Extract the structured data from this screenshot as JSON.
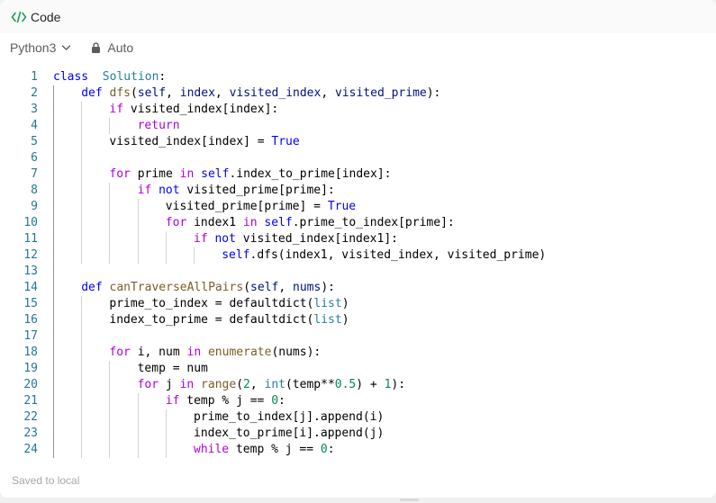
{
  "title": {
    "label": "Code",
    "icon": "code-icon"
  },
  "toolbar": {
    "language": "Python3",
    "mode_label": "Auto"
  },
  "status": {
    "text": "Saved to local"
  },
  "colors": {
    "keyword": "#0000ff",
    "control": "#af00db",
    "type": "#267f99",
    "function": "#795e26",
    "param": "#001080",
    "number": "#098658",
    "line_number": "#237893"
  },
  "code": {
    "lines": [
      {
        "n": "1",
        "indent": 0,
        "tokens": [
          [
            "k",
            "class"
          ],
          [
            "",
            "  "
          ],
          [
            "t",
            "Solution"
          ],
          [
            "",
            ":"
          ]
        ]
      },
      {
        "n": "2",
        "indent": 1,
        "tokens": [
          [
            "k",
            "def"
          ],
          [
            "",
            " "
          ],
          [
            "f",
            "dfs"
          ],
          [
            "",
            "("
          ],
          [
            "p",
            "self"
          ],
          [
            "",
            ", "
          ],
          [
            "p",
            "index"
          ],
          [
            "",
            ", "
          ],
          [
            "p",
            "visited_index"
          ],
          [
            "",
            ", "
          ],
          [
            "p",
            "visited_prime"
          ],
          [
            "",
            "):"
          ]
        ]
      },
      {
        "n": "3",
        "indent": 2,
        "tokens": [
          [
            "c",
            "if"
          ],
          [
            "",
            " visited_index[index]:"
          ]
        ]
      },
      {
        "n": "4",
        "indent": 3,
        "tokens": [
          [
            "c",
            "return"
          ]
        ]
      },
      {
        "n": "5",
        "indent": 2,
        "tokens": [
          [
            "",
            "visited_index[index] = "
          ],
          [
            "s",
            "True"
          ]
        ]
      },
      {
        "n": "6",
        "indent": 0,
        "tokens": []
      },
      {
        "n": "7",
        "indent": 2,
        "tokens": [
          [
            "c",
            "for"
          ],
          [
            "",
            " prime "
          ],
          [
            "c",
            "in"
          ],
          [
            "",
            " "
          ],
          [
            "s",
            "self"
          ],
          [
            "",
            ".index_to_prime[index]:"
          ]
        ]
      },
      {
        "n": "8",
        "indent": 3,
        "tokens": [
          [
            "c",
            "if"
          ],
          [
            "",
            " "
          ],
          [
            "k",
            "not"
          ],
          [
            "",
            " visited_prime[prime]:"
          ]
        ]
      },
      {
        "n": "9",
        "indent": 4,
        "tokens": [
          [
            "",
            "visited_prime[prime] = "
          ],
          [
            "s",
            "True"
          ]
        ]
      },
      {
        "n": "10",
        "indent": 4,
        "tokens": [
          [
            "c",
            "for"
          ],
          [
            "",
            " index1 "
          ],
          [
            "c",
            "in"
          ],
          [
            "",
            " "
          ],
          [
            "s",
            "self"
          ],
          [
            "",
            ".prime_to_index[prime]:"
          ]
        ]
      },
      {
        "n": "11",
        "indent": 5,
        "tokens": [
          [
            "c",
            "if"
          ],
          [
            "",
            " "
          ],
          [
            "k",
            "not"
          ],
          [
            "",
            " visited_index[index1]:"
          ]
        ]
      },
      {
        "n": "12",
        "indent": 6,
        "tokens": [
          [
            "s",
            "self"
          ],
          [
            "",
            ".dfs(index1, visited_index, visited_prime)"
          ]
        ]
      },
      {
        "n": "13",
        "indent": 0,
        "tokens": []
      },
      {
        "n": "14",
        "indent": 1,
        "tokens": [
          [
            "k",
            "def"
          ],
          [
            "",
            " "
          ],
          [
            "f",
            "canTraverseAllPairs"
          ],
          [
            "",
            "("
          ],
          [
            "p",
            "self"
          ],
          [
            "",
            ", "
          ],
          [
            "p",
            "nums"
          ],
          [
            "",
            "):"
          ]
        ]
      },
      {
        "n": "15",
        "indent": 2,
        "tokens": [
          [
            "",
            "prime_to_index = defaultdict("
          ],
          [
            "t",
            "list"
          ],
          [
            "",
            ")"
          ]
        ]
      },
      {
        "n": "16",
        "indent": 2,
        "tokens": [
          [
            "",
            "index_to_prime = defaultdict("
          ],
          [
            "t",
            "list"
          ],
          [
            "",
            ")"
          ]
        ]
      },
      {
        "n": "17",
        "indent": 0,
        "tokens": []
      },
      {
        "n": "18",
        "indent": 2,
        "tokens": [
          [
            "c",
            "for"
          ],
          [
            "",
            " i, num "
          ],
          [
            "c",
            "in"
          ],
          [
            "",
            " "
          ],
          [
            "f",
            "enumerate"
          ],
          [
            "",
            "(nums):"
          ]
        ]
      },
      {
        "n": "19",
        "indent": 3,
        "tokens": [
          [
            "",
            "temp = num"
          ]
        ]
      },
      {
        "n": "20",
        "indent": 3,
        "tokens": [
          [
            "c",
            "for"
          ],
          [
            "",
            " j "
          ],
          [
            "c",
            "in"
          ],
          [
            "",
            " "
          ],
          [
            "f",
            "range"
          ],
          [
            "",
            "("
          ],
          [
            "n",
            "2"
          ],
          [
            "",
            ", "
          ],
          [
            "t",
            "int"
          ],
          [
            "",
            "(temp**"
          ],
          [
            "n",
            "0.5"
          ],
          [
            "",
            ") + "
          ],
          [
            "n",
            "1"
          ],
          [
            "",
            "):"
          ]
        ]
      },
      {
        "n": "21",
        "indent": 4,
        "tokens": [
          [
            "c",
            "if"
          ],
          [
            "",
            " temp % j == "
          ],
          [
            "n",
            "0"
          ],
          [
            "",
            ":"
          ]
        ]
      },
      {
        "n": "22",
        "indent": 5,
        "tokens": [
          [
            "",
            "prime_to_index[j].append(i)"
          ]
        ]
      },
      {
        "n": "23",
        "indent": 5,
        "tokens": [
          [
            "",
            "index_to_prime[i].append(j)"
          ]
        ]
      },
      {
        "n": "24",
        "indent": 5,
        "tokens": [
          [
            "c",
            "while"
          ],
          [
            "",
            " temp % j == "
          ],
          [
            "n",
            "0"
          ],
          [
            "",
            ":"
          ]
        ]
      }
    ]
  }
}
